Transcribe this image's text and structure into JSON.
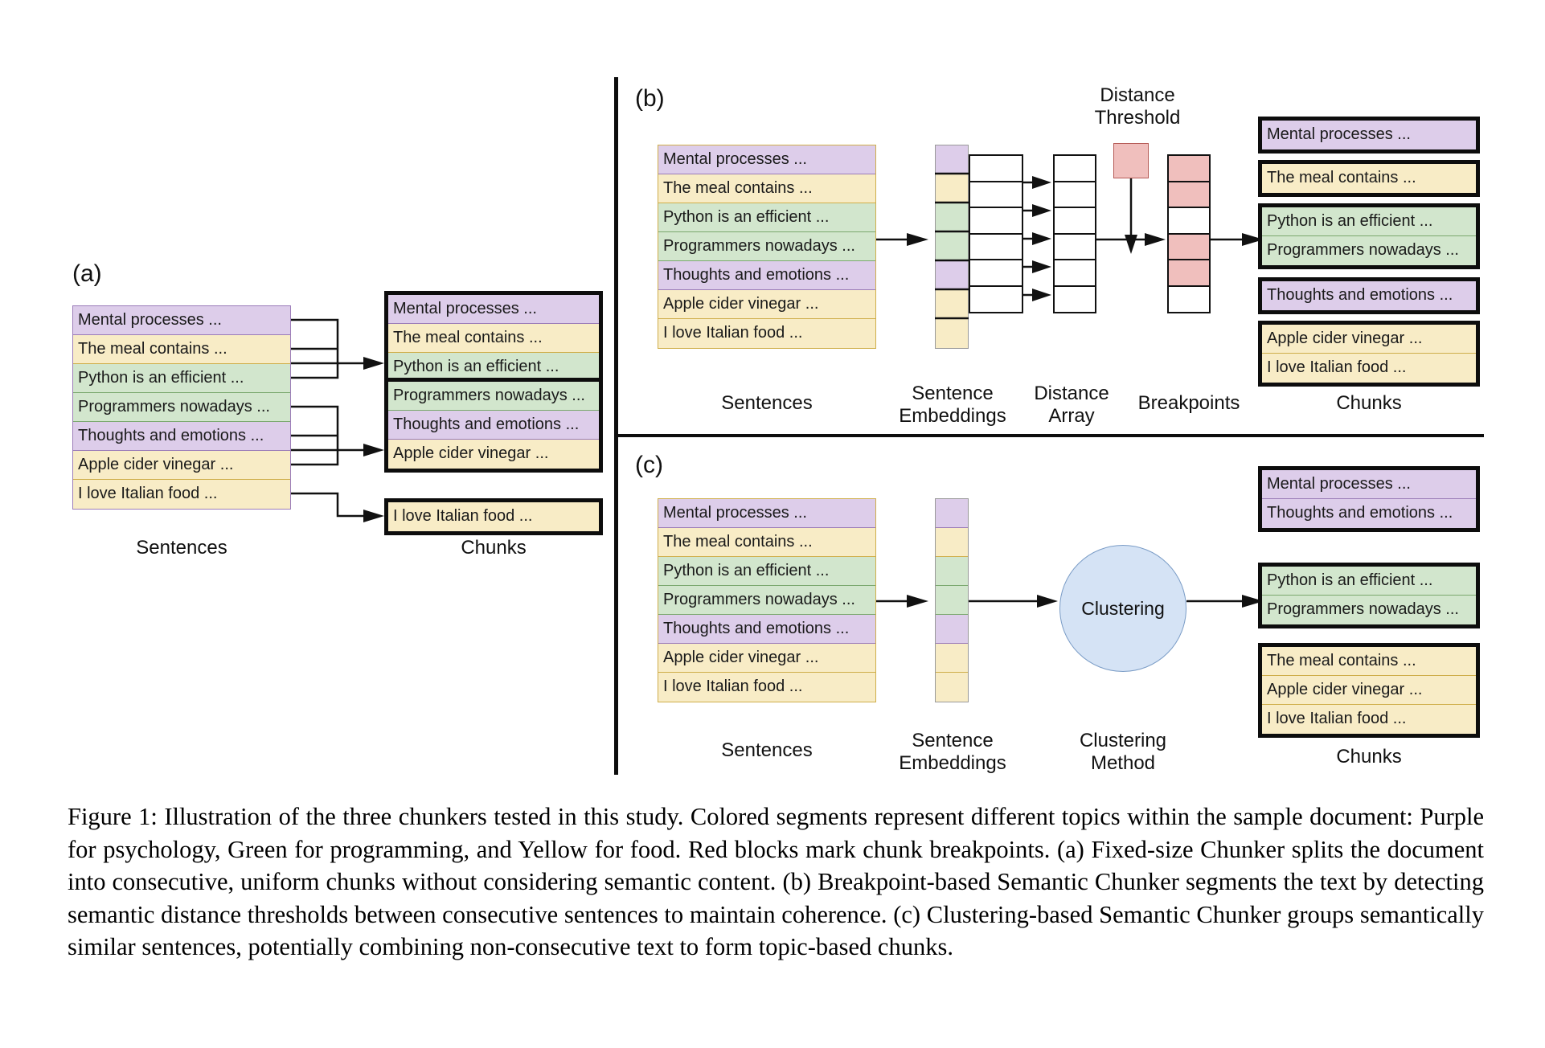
{
  "figure": {
    "panels": {
      "a": {
        "label": "(a)",
        "sentences_label": "Sentences",
        "chunks_label": "Chunks",
        "sentences": [
          {
            "text": "Mental processes ...",
            "topic": "purple"
          },
          {
            "text": "The meal contains ...",
            "topic": "yellow"
          },
          {
            "text": "Python is an efficient ...",
            "topic": "green"
          },
          {
            "text": "Programmers nowadays ...",
            "topic": "green"
          },
          {
            "text": "Thoughts and emotions ...",
            "topic": "purple"
          },
          {
            "text": "Apple cider vinegar ...",
            "topic": "yellow"
          },
          {
            "text": "I love Italian food ...",
            "topic": "yellow"
          }
        ],
        "chunks": [
          [
            {
              "text": "Mental processes ...",
              "topic": "purple"
            },
            {
              "text": "The meal contains ...",
              "topic": "yellow"
            },
            {
              "text": "Python is an efficient ...",
              "topic": "green"
            }
          ],
          [
            {
              "text": "Programmers nowadays ...",
              "topic": "green"
            },
            {
              "text": "Thoughts and emotions ...",
              "topic": "purple"
            },
            {
              "text": "Apple cider vinegar ...",
              "topic": "yellow"
            }
          ],
          [
            {
              "text": "I love Italian food ...",
              "topic": "yellow"
            }
          ]
        ]
      },
      "b": {
        "label": "(b)",
        "sentences_label": "Sentences",
        "embeddings_label": "Sentence\nEmbeddings",
        "embeddings_label_l1": "Sentence",
        "embeddings_label_l2": "Embeddings",
        "distance_label_l1": "Distance",
        "distance_label_l2": "Array",
        "breakpoints_label": "Breakpoints",
        "chunks_label": "Chunks",
        "threshold_label_l1": "Distance",
        "threshold_label_l2": "Threshold",
        "sentences": [
          {
            "text": "Mental processes ...",
            "topic": "purple"
          },
          {
            "text": "The meal contains ...",
            "topic": "yellow"
          },
          {
            "text": "Python is an efficient ...",
            "topic": "green"
          },
          {
            "text": "Programmers nowadays ...",
            "topic": "green"
          },
          {
            "text": "Thoughts and emotions ...",
            "topic": "purple"
          },
          {
            "text": "Apple cider vinegar ...",
            "topic": "yellow"
          },
          {
            "text": "I love Italian food ...",
            "topic": "yellow"
          }
        ],
        "embeddings": [
          "purple",
          "yellow",
          "green",
          "green",
          "purple",
          "yellow",
          "yellow"
        ],
        "distance_array_cells": 6,
        "distance_out_cells": 6,
        "breakpoints": [
          "red",
          "red",
          "white",
          "red",
          "red",
          "white"
        ],
        "chunks": [
          [
            {
              "text": "Mental processes ...",
              "topic": "purple"
            }
          ],
          [
            {
              "text": "The meal contains ...",
              "topic": "yellow"
            }
          ],
          [
            {
              "text": "Python is an efficient ...",
              "topic": "green"
            },
            {
              "text": "Programmers nowadays ...",
              "topic": "green"
            }
          ],
          [
            {
              "text": "Thoughts and emotions ...",
              "topic": "purple"
            }
          ],
          [
            {
              "text": "Apple cider vinegar ...",
              "topic": "yellow"
            },
            {
              "text": "I love Italian food ...",
              "topic": "yellow"
            }
          ]
        ]
      },
      "c": {
        "label": "(c)",
        "sentences_label": "Sentences",
        "embeddings_label_l1": "Sentence",
        "embeddings_label_l2": "Embeddings",
        "clustering_label_l1": "Clustering",
        "clustering_label_l2": "Method",
        "clustering_node_label": "Clustering",
        "chunks_label": "Chunks",
        "sentences": [
          {
            "text": "Mental processes ...",
            "topic": "purple"
          },
          {
            "text": "The meal contains ...",
            "topic": "yellow"
          },
          {
            "text": "Python is an efficient ...",
            "topic": "green"
          },
          {
            "text": "Programmers nowadays ...",
            "topic": "green"
          },
          {
            "text": "Thoughts and emotions ...",
            "topic": "purple"
          },
          {
            "text": "Apple cider vinegar ...",
            "topic": "yellow"
          },
          {
            "text": "I love Italian food ...",
            "topic": "yellow"
          }
        ],
        "embeddings": [
          "purple",
          "yellow",
          "green",
          "green",
          "purple",
          "yellow",
          "yellow"
        ],
        "chunks": [
          [
            {
              "text": "Mental processes ...",
              "topic": "purple"
            },
            {
              "text": "Thoughts and emotions ...",
              "topic": "purple"
            }
          ],
          [
            {
              "text": "Python is an efficient ...",
              "topic": "green"
            },
            {
              "text": "Programmers nowadays ...",
              "topic": "green"
            }
          ],
          [
            {
              "text": "The meal contains ...",
              "topic": "yellow"
            },
            {
              "text": "Apple cider vinegar ...",
              "topic": "yellow"
            },
            {
              "text": "I love Italian food ...",
              "topic": "yellow"
            }
          ]
        ]
      }
    },
    "caption": "Figure 1: Illustration of the three chunkers tested in this study. Colored segments represent different topics within the sample document: Purple for psychology, Green for programming, and Yellow for food. Red blocks mark chunk breakpoints. (a) Fixed-size Chunker splits the document into consecutive, uniform chunks without considering semantic content. (b) Breakpoint-based Semantic Chunker segments the text by detecting semantic distance thresholds between consecutive sentences to maintain coherence. (c) Clustering-based Semantic Chunker groups semantically similar sentences, potentially combining non-consecutive text to form topic-based chunks.",
    "colors": {
      "purple": "#ddcdea",
      "yellow": "#f8ecc6",
      "green": "#d2e6cd",
      "red": "#f0bfbd",
      "cluster_blue": "#d5e3f5",
      "border_black": "#0d0d0d"
    }
  }
}
